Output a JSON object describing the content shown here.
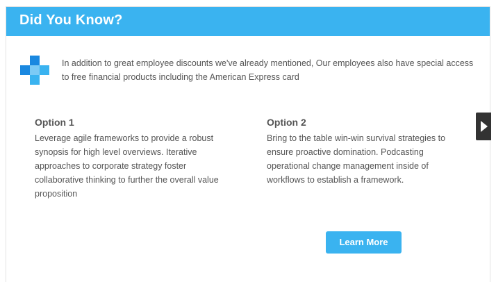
{
  "header": {
    "title": "Did You Know?"
  },
  "intro": {
    "icon": "blue-pixel-plus-logo-icon",
    "text": "In addition to great employee discounts we've already mentioned, Our employees also have special access to free financial products including the American Express card"
  },
  "options": [
    {
      "title": "Option 1",
      "text": "Leverage agile frameworks to provide a robust synopsis for high level overviews. Iterative approaches to corporate strategy foster collaborative thinking to further the overall value proposition"
    },
    {
      "title": "Option 2",
      "text": "Bring to the table win-win survival strategies to ensure proactive domination. Podcasting operational change management inside of workflows to establish a framework."
    }
  ],
  "navigation": {
    "next_icon": "chevron-right-icon"
  },
  "cta": {
    "label": "Learn More"
  },
  "colors": {
    "accent": "#3ab3f0",
    "text": "#555555",
    "arrow_bg": "#333333"
  }
}
